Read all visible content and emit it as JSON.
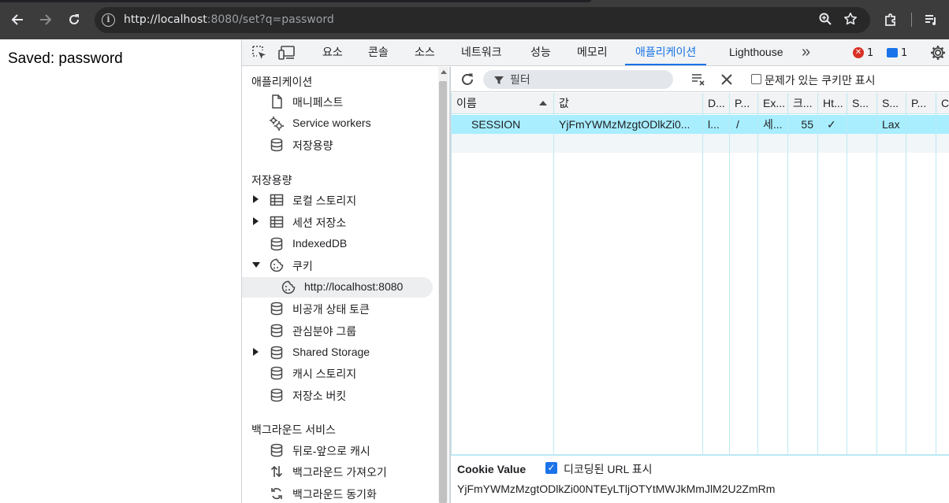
{
  "browser": {
    "url_scheme_host": "http://localhost",
    "url_port": ":8080",
    "url_path": "/set?q=password",
    "icons": [
      "back-icon",
      "forward-icon",
      "reload-icon",
      "site-info-icon",
      "zoom-icon",
      "bookmark-star-icon",
      "extensions-icon",
      "reading-list-icon"
    ]
  },
  "page": {
    "text": "Saved: password"
  },
  "devtools": {
    "tabs": [
      {
        "label": "요소"
      },
      {
        "label": "콘솔"
      },
      {
        "label": "소스"
      },
      {
        "label": "네트워크"
      },
      {
        "label": "성능"
      },
      {
        "label": "메모리"
      },
      {
        "label": "애플리케이션"
      },
      {
        "label": "Lighthouse"
      }
    ],
    "active_tab": "애플리케이션",
    "more_tabs_glyph": "»",
    "error_count": "1",
    "message_count": "1",
    "accent_color": "#1a73e8",
    "sidebar": {
      "app_heading": "애플리케이션",
      "app_items": [
        {
          "label": "매니페스트",
          "icon": "document-icon"
        },
        {
          "label": "Service workers",
          "icon": "gears-icon"
        },
        {
          "label": "저장용량",
          "icon": "database-icon"
        }
      ],
      "storage_heading": "저장용량",
      "storage_items": [
        {
          "label": "로컬 스토리지",
          "icon": "table-icon"
        },
        {
          "label": "세션 저장소",
          "icon": "table-icon"
        },
        {
          "label": "IndexedDB",
          "icon": "database-icon"
        },
        {
          "label": "쿠키",
          "icon": "cookie-icon"
        },
        {
          "label": "http://localhost:8080",
          "icon": "cookie-icon"
        },
        {
          "label": "비공개 상태 토큰",
          "icon": "database-icon"
        },
        {
          "label": "관심분야 그룹",
          "icon": "database-icon"
        },
        {
          "label": "Shared Storage",
          "icon": "database-icon"
        },
        {
          "label": "캐시 스토리지",
          "icon": "database-icon"
        },
        {
          "label": "저장소 버킷",
          "icon": "database-icon"
        }
      ],
      "bg_heading": "백그라운드 서비스",
      "bg_items": [
        {
          "label": "뒤로-앞으로 캐시",
          "icon": "database-icon"
        },
        {
          "label": "백그라운드 가져오기",
          "icon": "fetch-arrows-icon"
        },
        {
          "label": "백그라운드 동기화",
          "icon": "sync-icon"
        }
      ]
    },
    "cookies": {
      "filter_placeholder": "필터",
      "only_issues_label": "문제가 있는 쿠키만 표시",
      "only_issues_checked": false,
      "columns": [
        "이름",
        "값",
        "D...",
        "P...",
        "Ex...",
        "크...",
        "Ht...",
        "S...",
        "S...",
        "P...",
        "Cr"
      ],
      "rows": [
        {
          "name": "SESSION",
          "value": "YjFmYWMzMzgtODlkZi0...",
          "domain": "l...",
          "path": "/",
          "expires": "세...",
          "size": "55",
          "httponly": "✓",
          "secure": "",
          "samesite": "Lax",
          "partition": "",
          "cross": ""
        }
      ],
      "cookie_value_label": "Cookie Value",
      "decode_label": "디코딩된 URL 표시",
      "decode_checked": true,
      "cookie_value": "YjFmYWMzMzgtODlkZi00NTEyLTljOTYtMWJkMmJlM2U2ZmRm"
    }
  }
}
